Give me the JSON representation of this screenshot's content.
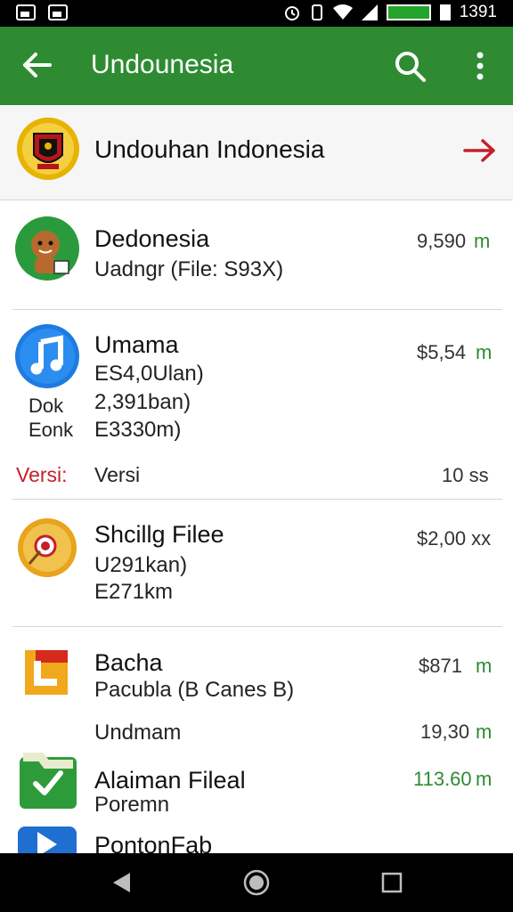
{
  "status_bar": {
    "time": "1391"
  },
  "toolbar": {
    "title": "Undounesia"
  },
  "header": {
    "title": "Undouhan Indonesia"
  },
  "items": [
    {
      "name": "Dedonesia",
      "lines": [
        "Uadngr (File: S93X)"
      ],
      "price": "9,590",
      "price_unit": "m"
    },
    {
      "name": "Umama",
      "lines": [
        "ES4,0Ulan)",
        "2,391ban)",
        "E3330m)"
      ],
      "price": "$5,54",
      "price_unit": "m",
      "icon_caption": [
        "Dok",
        "Eonk"
      ]
    },
    {
      "name": "Shcillg Filee",
      "lines": [
        "U291kan)",
        "E271km"
      ],
      "price": "$2,00 xx"
    },
    {
      "name": "Bacha",
      "lines": [
        "Pacubla (B Canes B)"
      ],
      "price": "$871",
      "price_unit": "m"
    },
    {
      "name": "Alaiman Fileal",
      "lines": [
        "Poremn"
      ],
      "price": "113.60",
      "price_unit": "m"
    },
    {
      "name": "PontonFab",
      "lines": []
    }
  ],
  "version_row": {
    "label_red": "Versi:",
    "label": "Versi",
    "value": "10 ss"
  },
  "undmam_row": {
    "label": "Undmam",
    "value": "19,30",
    "unit": "m"
  }
}
